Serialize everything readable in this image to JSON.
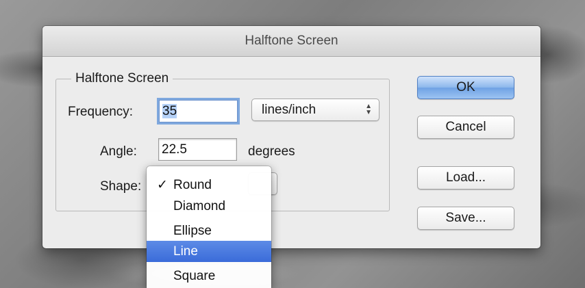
{
  "dialog": {
    "title": "Halftone Screen",
    "group_title": "Halftone Screen",
    "frequency": {
      "label": "Frequency:",
      "value": "35",
      "unit": "lines/inch"
    },
    "angle": {
      "label": "Angle:",
      "value": "22.5",
      "unit": "degrees"
    },
    "shape": {
      "label": "Shape:"
    },
    "buttons": {
      "ok": "OK",
      "cancel": "Cancel",
      "load": "Load...",
      "save": "Save..."
    }
  },
  "shape_menu": {
    "checkmark": "✓",
    "items": [
      "Round",
      "Diamond",
      "Ellipse",
      "Line",
      "Square"
    ],
    "checked": "Round",
    "highlighted": "Line"
  }
}
